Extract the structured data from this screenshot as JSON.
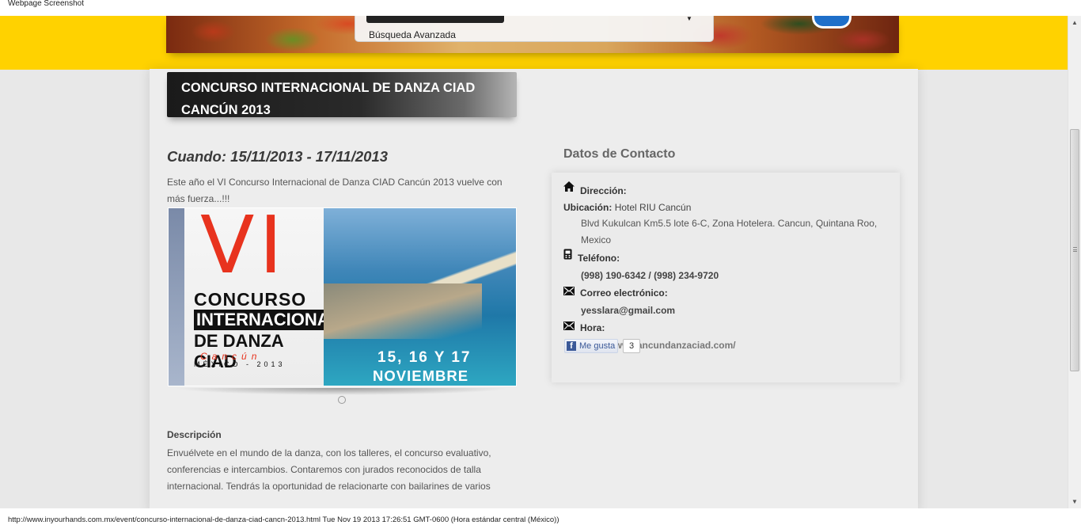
{
  "screenshot_title": "Webpage Screenshot",
  "header": {
    "advanced_search": "Búsqueda Avanzada"
  },
  "event": {
    "title": "CONCURSO INTERNACIONAL DE DANZA CIAD CANCÚN 2013",
    "when": "Cuando: 15/11/2013 - 17/11/2013",
    "intro": "Este año el VI Concurso Internacional de Danza CIAD Cancún 2013 vuelve con más fuerza...!!!",
    "description_label": "Descripción",
    "description": "Envuélvete en el mundo de la danza, con los talleres, el concurso evaluativo, conferencias e intercambios. Contaremos con jurados reconocidos de talla internacional. Tendrás la oportunidad de relacionarte con bailarines de varios"
  },
  "poster": {
    "roman": "VI",
    "line1": "CONCURSO",
    "line2": "INTERNACIONAL",
    "line3": "DE DANZA CIAD",
    "city": "Cancún",
    "country_year": "MÉXICO - 2013",
    "dates_line1": "15, 16 Y 17",
    "dates_line2": "NOVIEMBRE"
  },
  "contact": {
    "heading": "Datos de Contacto",
    "address_label": "Dirección:",
    "location_label": "Ubicación:",
    "location_value": "Hotel RIU Cancún",
    "address_value": "Blvd Kukulcan Km5.5 lote 6-C, Zona Hotelera. Cancun, Quintana Roo, Mexico",
    "phone_label": "Teléfono:",
    "phone_value": "(998) 190-6342 / (998) 234-9720",
    "email_label": "Correo electrónico:",
    "email_value": "yesslara@gmail.com",
    "hours_label": "Hora:",
    "website": "http://www.cancundanzaciad.com/",
    "like_label": "Me gusta",
    "like_count": "3"
  },
  "footer": {
    "status": "http://www.inyourhands.com.mx/event/concurso-internacional-de-danza-ciad-cancn-2013.html Tue Nov 19 2013 17:26:51 GMT-0600 (Hora estándar central (México))"
  },
  "icons": {
    "address": "home-icon",
    "phone": "phone-icon",
    "email": "envelope-icon",
    "hours": "envelope-icon",
    "facebook": "facebook-icon"
  },
  "colors": {
    "header_yellow": "#ffd200",
    "title_bar": "#1a1a1a",
    "facebook_blue": "#3b5998"
  }
}
